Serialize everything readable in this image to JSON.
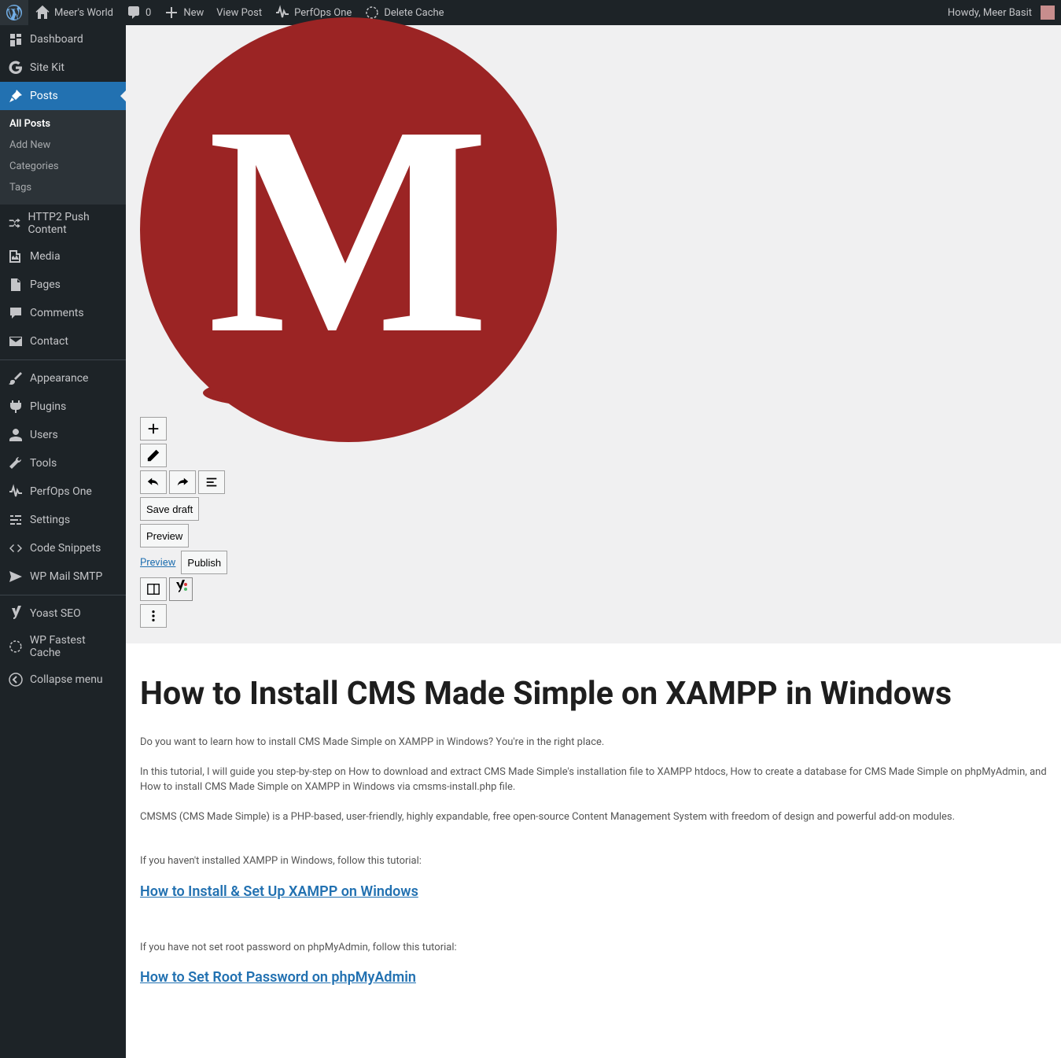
{
  "toolbar": {
    "site_name": "Meer's World",
    "comments": "0",
    "new": "New",
    "view_post": "View Post",
    "perfops": "PerfOps One",
    "delete_cache": "Delete Cache",
    "howdy": "Howdy, Meer Basit"
  },
  "sidebar": {
    "dashboard": "Dashboard",
    "sitekit": "Site Kit",
    "posts": "Posts",
    "sub_all_posts": "All Posts",
    "sub_add_new": "Add New",
    "sub_categories": "Categories",
    "sub_tags": "Tags",
    "http2": "HTTP2 Push Content",
    "media": "Media",
    "pages": "Pages",
    "comments": "Comments",
    "contact": "Contact",
    "appearance": "Appearance",
    "plugins": "Plugins",
    "users": "Users",
    "tools": "Tools",
    "perfops": "PerfOps One",
    "settings": "Settings",
    "code_snippets": "Code Snippets",
    "wp_mail": "WP Mail SMTP",
    "yoast": "Yoast SEO",
    "fastest_cache": "WP Fastest Cache",
    "collapse": "Collapse menu"
  },
  "editor": {
    "save_draft": "Save draft",
    "preview_btn": "Preview",
    "preview_link": "Preview",
    "publish": "Publish",
    "logo_letter": "M"
  },
  "post": {
    "title": "How to Install CMS Made Simple on XAMPP in Windows",
    "p1": "Do you want to learn how to install CMS Made Simple on XAMPP in Windows? You're in the right place.",
    "p2": "In this tutorial, I will guide you step-by-step on How to download and extract CMS Made Simple's installation file to XAMPP htdocs, How to create a database for CMS Made Simple on phpMyAdmin, and How to install CMS Made Simple on XAMPP in Windows via cmsms-install.php file.",
    "p3": "CMSMS (CMS Made Simple) is a PHP-based, user-friendly, highly expandable, free open-source Content Management System with freedom of design and powerful add-on modules.",
    "p4": "If you haven't installed XAMPP in Windows, follow this tutorial:",
    "link1": "How to Install & Set Up XAMPP on Windows",
    "p5": "If you have not set root password on phpMyAdmin, follow this tutorial:",
    "link2": "How to Set Root Password on phpMyAdmin"
  }
}
